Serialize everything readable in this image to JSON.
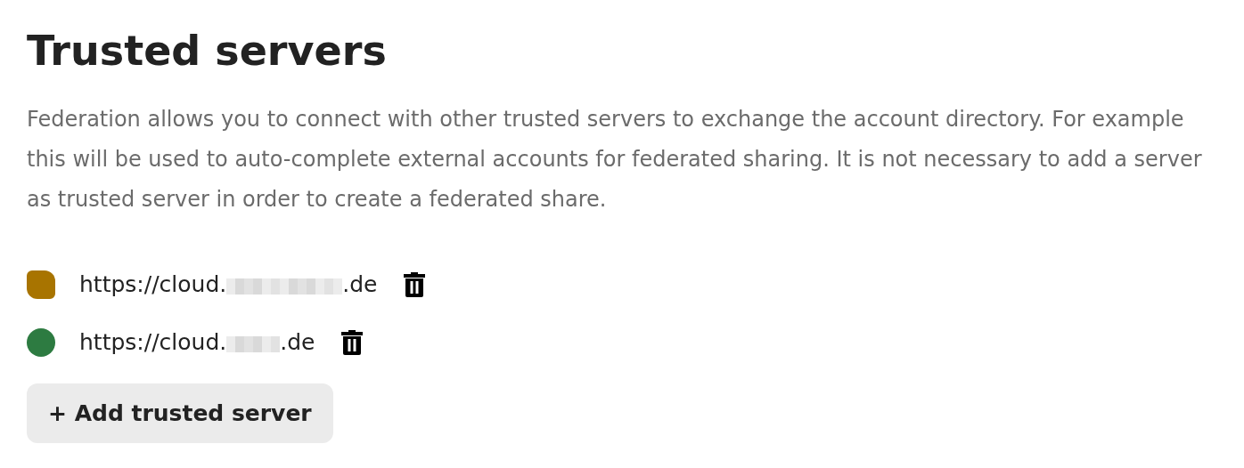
{
  "title": "Trusted servers",
  "description": "Federation allows you to connect with other trusted servers to exchange the account directory. For example this will be used to auto-complete external accounts for federated sharing. It is not necessary to add a server as trusted server in order to create a federated share.",
  "servers": [
    {
      "kind": "pending",
      "color": "#a87400",
      "url_start": "https://cloud.",
      "url_end": ".de",
      "redaction": {
        "kind": "wide"
      }
    },
    {
      "kind": "ok",
      "color": "#2d7b41",
      "url_start": "https://cloud.",
      "url_end": ".de",
      "redaction": {
        "kind": "narrow"
      }
    }
  ],
  "add_button": "+ Add trusted server"
}
